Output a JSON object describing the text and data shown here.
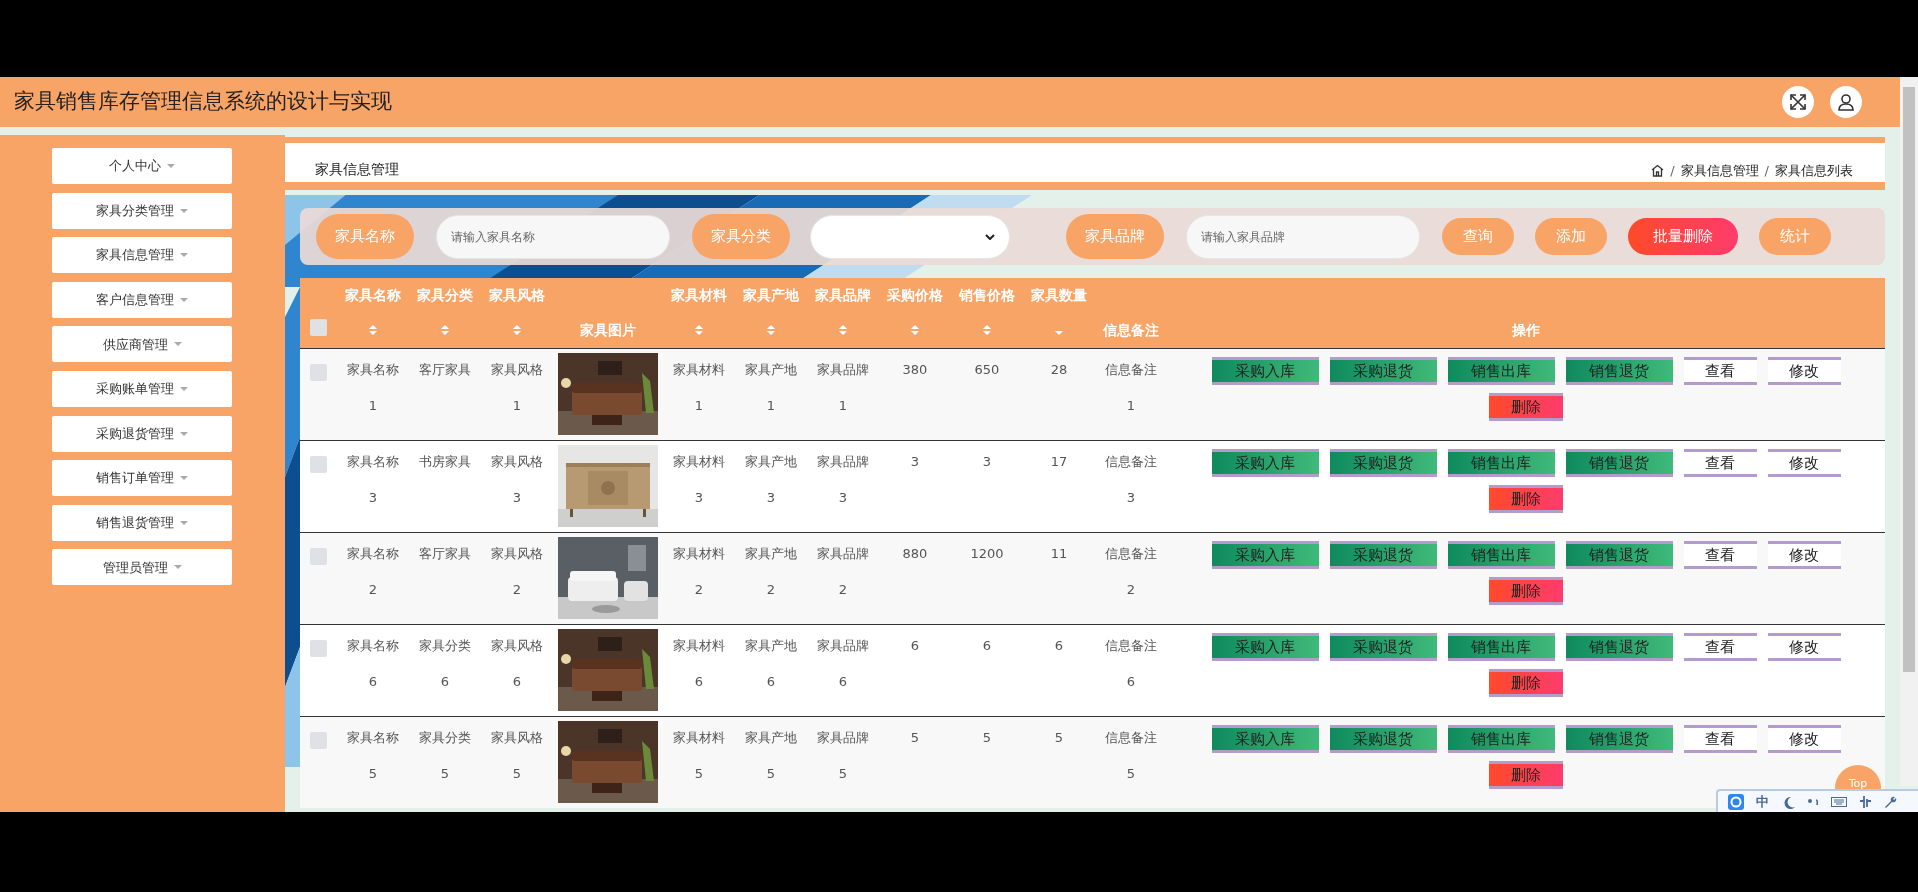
{
  "app": {
    "title": "家具销售库存管理信息系统的设计与实现"
  },
  "sidebar": {
    "items": [
      {
        "label": "个人中心"
      },
      {
        "label": "家具分类管理"
      },
      {
        "label": "家具信息管理"
      },
      {
        "label": "客户信息管理"
      },
      {
        "label": "供应商管理"
      },
      {
        "label": "采购账单管理"
      },
      {
        "label": "采购退货管理"
      },
      {
        "label": "销售订单管理"
      },
      {
        "label": "销售退货管理"
      },
      {
        "label": "管理员管理"
      }
    ]
  },
  "page": {
    "title": "家具信息管理",
    "breadcrumb": [
      {
        "kind": "separator",
        "text": "/"
      },
      {
        "kind": "link",
        "text": "家具信息管理"
      },
      {
        "kind": "separator",
        "text": "/"
      },
      {
        "kind": "link",
        "text": "家具信息列表"
      }
    ]
  },
  "search": {
    "fields": [
      {
        "kind": "input",
        "label": "家具名称",
        "placeholder": "请输入家具名称"
      },
      {
        "kind": "select",
        "label": "家具分类"
      },
      {
        "kind": "input",
        "label": "家具品牌",
        "placeholder": "请输入家具品牌"
      }
    ],
    "buttons": [
      {
        "label": "查询",
        "kind": "normal"
      },
      {
        "label": "添加",
        "kind": "normal"
      },
      {
        "label": "批量删除",
        "kind": "danger"
      },
      {
        "label": "统计",
        "kind": "normal"
      }
    ]
  },
  "table": {
    "all_checked": false,
    "columns": [
      {
        "kind": "text",
        "label": "家具名称",
        "sortable": true,
        "sorted": false
      },
      {
        "kind": "text",
        "label": "家具分类",
        "sortable": true,
        "sorted": false
      },
      {
        "kind": "text",
        "label": "家具风格",
        "sortable": true,
        "sorted": false
      },
      {
        "label": "家具图片"
      },
      {
        "kind": "text",
        "label": "家具材料",
        "sortable": true,
        "sorted": false
      },
      {
        "kind": "text",
        "label": "家具产地",
        "sortable": true,
        "sorted": false
      },
      {
        "kind": "text",
        "label": "家具品牌",
        "sortable": true,
        "sorted": false
      },
      {
        "kind": "text",
        "label": "采购价格",
        "sortable": true,
        "sorted": false
      },
      {
        "kind": "text",
        "label": "销售价格",
        "sortable": true,
        "sorted": false
      },
      {
        "kind": "text",
        "label": "家具数量",
        "sortable": true,
        "sorted": true
      },
      {
        "kind": "text",
        "label": "信息备注"
      },
      {
        "kind": "actions",
        "label": "操作"
      }
    ],
    "rows": [
      {
        "checked": false,
        "cells": [
          "家具名称1",
          "客厅家具",
          "家具风格1",
          "",
          "家具材料1",
          "家具产地1",
          "家具品牌1",
          "380",
          "650",
          "28",
          "信息备注1"
        ],
        "actions": [
          {
            "label": "采购入库",
            "kind": "green"
          },
          {
            "label": "采购退货",
            "kind": "green"
          },
          {
            "label": "销售出库",
            "kind": "green"
          },
          {
            "label": "销售退货",
            "kind": "green"
          },
          {
            "label": "查看",
            "kind": "plain"
          },
          {
            "label": "修改",
            "kind": "plain"
          },
          {
            "label": "删除",
            "kind": "danger"
          }
        ]
      },
      {
        "checked": false,
        "cells": [
          "家具名称3",
          "书房家具",
          "家具风格3",
          "",
          "家具材料3",
          "家具产地3",
          "家具品牌3",
          "3",
          "3",
          "17",
          "信息备注3"
        ],
        "actions": [
          {
            "label": "采购入库",
            "kind": "green"
          },
          {
            "label": "采购退货",
            "kind": "green"
          },
          {
            "label": "销售出库",
            "kind": "green"
          },
          {
            "label": "销售退货",
            "kind": "green"
          },
          {
            "label": "查看",
            "kind": "plain"
          },
          {
            "label": "修改",
            "kind": "plain"
          },
          {
            "label": "删除",
            "kind": "danger"
          }
        ]
      },
      {
        "checked": false,
        "cells": [
          "家具名称2",
          "客厅家具",
          "家具风格2",
          "",
          "家具材料2",
          "家具产地2",
          "家具品牌2",
          "880",
          "1200",
          "11",
          "信息备注2"
        ],
        "actions": [
          {
            "label": "采购入库",
            "kind": "green"
          },
          {
            "label": "采购退货",
            "kind": "green"
          },
          {
            "label": "销售出库",
            "kind": "green"
          },
          {
            "label": "销售退货",
            "kind": "green"
          },
          {
            "label": "查看",
            "kind": "plain"
          },
          {
            "label": "修改",
            "kind": "plain"
          },
          {
            "label": "删除",
            "kind": "danger"
          }
        ]
      },
      {
        "checked": false,
        "cells": [
          "家具名称6",
          "家具分类6",
          "家具风格6",
          "",
          "家具材料6",
          "家具产地6",
          "家具品牌6",
          "6",
          "6",
          "6",
          "信息备注6"
        ],
        "actions": [
          {
            "label": "采购入库",
            "kind": "green"
          },
          {
            "label": "采购退货",
            "kind": "green"
          },
          {
            "label": "销售出库",
            "kind": "green"
          },
          {
            "label": "销售退货",
            "kind": "green"
          },
          {
            "label": "查看",
            "kind": "plain"
          },
          {
            "label": "修改",
            "kind": "plain"
          },
          {
            "label": "删除",
            "kind": "danger"
          }
        ]
      },
      {
        "checked": false,
        "cells": [
          "家具名称5",
          "家具分类5",
          "家具风格5",
          "",
          "家具材料5",
          "家具产地5",
          "家具品牌5",
          "5",
          "5",
          "5",
          "信息备注5"
        ],
        "actions": [
          {
            "label": "采购入库",
            "kind": "green"
          },
          {
            "label": "采购退货",
            "kind": "green"
          },
          {
            "label": "销售出库",
            "kind": "green"
          },
          {
            "label": "销售退货",
            "kind": "green"
          },
          {
            "label": "查看",
            "kind": "plain"
          },
          {
            "label": "修改",
            "kind": "plain"
          },
          {
            "label": "删除",
            "kind": "danger"
          }
        ]
      }
    ]
  },
  "top_button": {
    "label": "Top"
  },
  "ime_bar": {
    "mode": "中"
  }
}
